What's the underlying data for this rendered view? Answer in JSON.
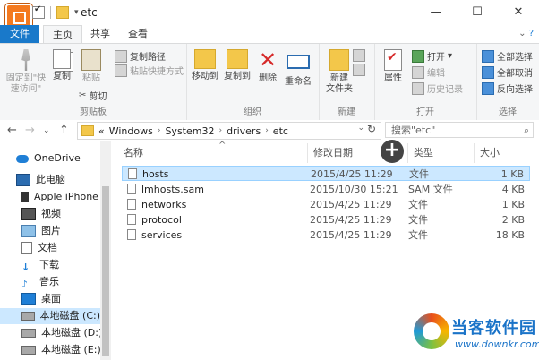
{
  "window": {
    "title": "etc"
  },
  "tabs": [
    {
      "label": "文件"
    },
    {
      "label": "主页"
    },
    {
      "label": "共享"
    },
    {
      "label": "查看"
    }
  ],
  "ribbon": {
    "groups": {
      "clipboard": "剪贴板",
      "organize": "组织",
      "new": "新建",
      "open": "打开",
      "select": "选择"
    },
    "pin_quick_access": "固定到\"快速访问\"",
    "copy": "复制",
    "paste": "粘贴",
    "copy_path": "复制路径",
    "paste_shortcut": "粘贴快捷方式",
    "cut": "剪切",
    "move_to": "移动到",
    "copy_to": "复制到",
    "delete": "删除",
    "rename": "重命名",
    "new_folder": "新建\n文件夹",
    "properties": "属性",
    "open": "打开",
    "edit": "编辑",
    "history": "历史记录",
    "select_all": "全部选择",
    "select_none": "全部取消",
    "invert_selection": "反向选择"
  },
  "address": {
    "crumbs": [
      "Windows",
      "System32",
      "drivers",
      "etc"
    ],
    "prefix": "«"
  },
  "search": {
    "placeholder": "搜索\"etc\""
  },
  "sidebar": {
    "items": [
      {
        "label": "OneDrive"
      },
      {
        "label": "此电脑"
      },
      {
        "label": "Apple iPhone"
      },
      {
        "label": "视频"
      },
      {
        "label": "图片"
      },
      {
        "label": "文档"
      },
      {
        "label": "下载"
      },
      {
        "label": "音乐"
      },
      {
        "label": "桌面"
      },
      {
        "label": "本地磁盘 (C:)"
      },
      {
        "label": "本地磁盘 (D:)"
      },
      {
        "label": "本地磁盘 (E:)"
      }
    ]
  },
  "columns": {
    "name": "名称",
    "date": "修改日期",
    "type": "类型",
    "size": "大小"
  },
  "files": [
    {
      "name": "hosts",
      "date": "2015/4/25 11:29",
      "type": "文件",
      "size": "1 KB"
    },
    {
      "name": "lmhosts.sam",
      "date": "2015/10/30 15:21",
      "type": "SAM 文件",
      "size": "4 KB"
    },
    {
      "name": "networks",
      "date": "2015/4/25 11:29",
      "type": "文件",
      "size": "1 KB"
    },
    {
      "name": "protocol",
      "date": "2015/4/25 11:29",
      "type": "文件",
      "size": "2 KB"
    },
    {
      "name": "services",
      "date": "2015/4/25 11:29",
      "type": "文件",
      "size": "18 KB"
    }
  ],
  "watermark": {
    "name": "当客软件园",
    "url": "www.downkr.com"
  }
}
